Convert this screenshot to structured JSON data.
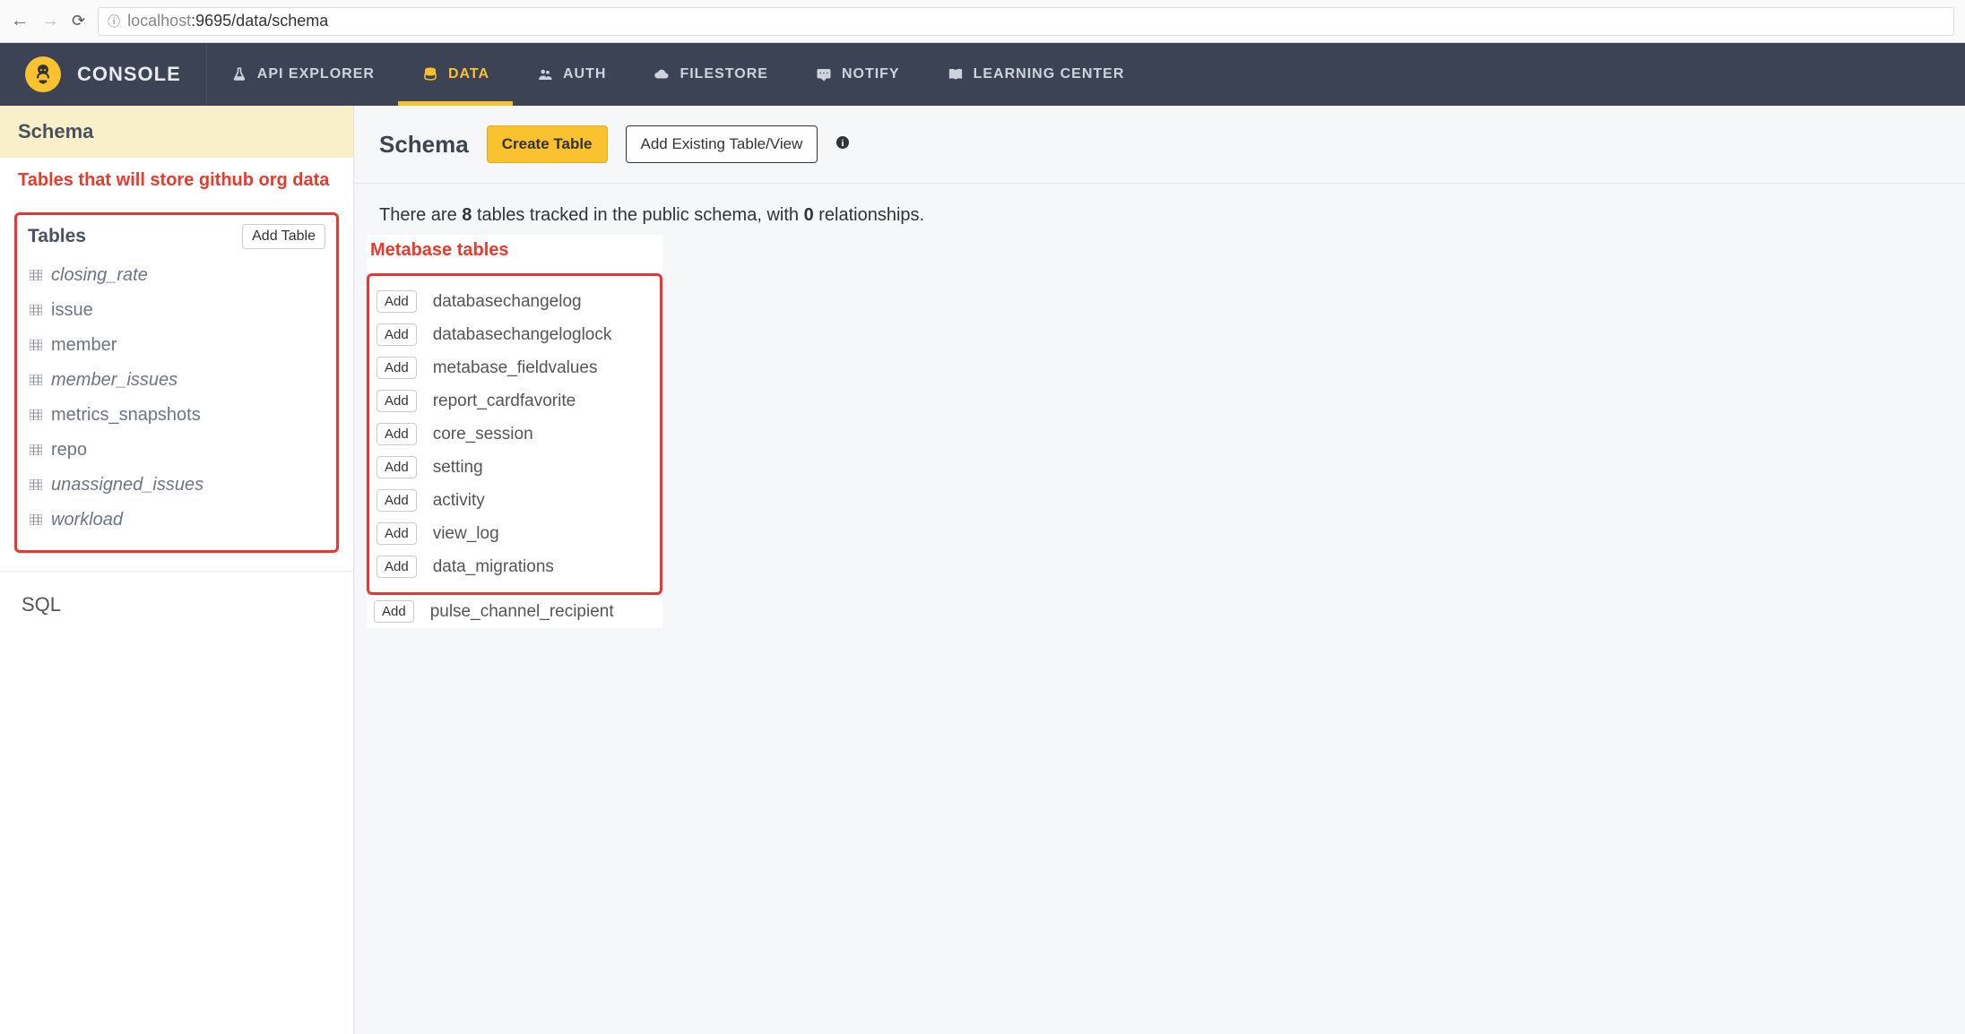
{
  "browser": {
    "url_host": "localhost",
    "url_path": ":9695/data/schema"
  },
  "brand": "CONSOLE",
  "nav": [
    {
      "label": "API EXPLORER",
      "icon": "flask-icon",
      "active": false
    },
    {
      "label": "DATA",
      "icon": "database-icon",
      "active": true
    },
    {
      "label": "AUTH",
      "icon": "users-icon",
      "active": false
    },
    {
      "label": "FILESTORE",
      "icon": "cloud-icon",
      "active": false
    },
    {
      "label": "NOTIFY",
      "icon": "comment-icon",
      "active": false
    },
    {
      "label": "LEARNING CENTER",
      "icon": "book-icon",
      "active": false
    }
  ],
  "sidebar": {
    "header": "Schema",
    "annotation": "Tables that will store github org data",
    "tables_heading": "Tables",
    "add_table_label": "Add Table",
    "tables": [
      {
        "name": "closing_rate",
        "italic": true
      },
      {
        "name": "issue",
        "italic": false
      },
      {
        "name": "member",
        "italic": false
      },
      {
        "name": "member_issues",
        "italic": true
      },
      {
        "name": "metrics_snapshots",
        "italic": false
      },
      {
        "name": "repo",
        "italic": false
      },
      {
        "name": "unassigned_issues",
        "italic": true
      },
      {
        "name": "workload",
        "italic": true
      }
    ],
    "sql_label": "SQL"
  },
  "main": {
    "title": "Schema",
    "create_table_label": "Create Table",
    "add_existing_label": "Add Existing Table/View",
    "status_prefix": "There are ",
    "tracked_count": "8",
    "status_mid": " tables tracked in the public schema, with ",
    "rel_count": "0",
    "status_suffix": " relationships.",
    "metabase_heading": "Metabase tables",
    "add_label": "Add",
    "metabase_tables_boxed": [
      "databasechangelog",
      "databasechangeloglock",
      "metabase_fieldvalues",
      "report_cardfavorite",
      "core_session",
      "setting",
      "activity",
      "view_log",
      "data_migrations"
    ],
    "metabase_tables_after": [
      "pulse_channel_recipient"
    ]
  }
}
